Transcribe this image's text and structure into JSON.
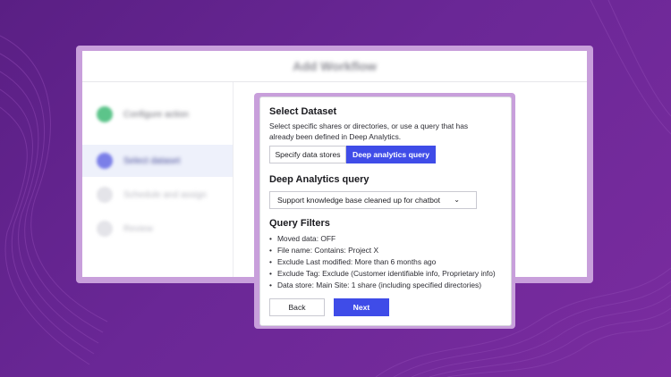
{
  "window": {
    "title": "Add Workflow"
  },
  "sidebar": {
    "steps": [
      {
        "label": "Configure action",
        "state": "done"
      },
      {
        "label": "Select dataset",
        "state": "active"
      },
      {
        "label": "Schedule and assign",
        "state": "pending"
      },
      {
        "label": "Review",
        "state": "pending"
      }
    ]
  },
  "modal": {
    "title": "Select Dataset",
    "description": "Select specific shares or directories, or use a query that has already been defined in Deep Analytics.",
    "toggle": {
      "option_specify": "Specify data stores",
      "option_query": "Deep analytics query",
      "selected": "Deep analytics query"
    },
    "query_section_title": "Deep Analytics query",
    "query_select_value": "Support knowledge base cleaned up for chatbot",
    "filters_title": "Query Filters",
    "filters": [
      "Moved data: OFF",
      "File name: Contains: Project X",
      "Exclude Last modified: More than 6 months ago",
      "Exclude Tag: Exclude (Customer identifiable info, Proprietary info)",
      "Data store: Main Site: 1 share (including specified directories)"
    ],
    "back_label": "Back",
    "next_label": "Next"
  },
  "colors": {
    "background": "#6a2796",
    "accent": "#3f4ce8",
    "frame": "#c89fdb"
  }
}
